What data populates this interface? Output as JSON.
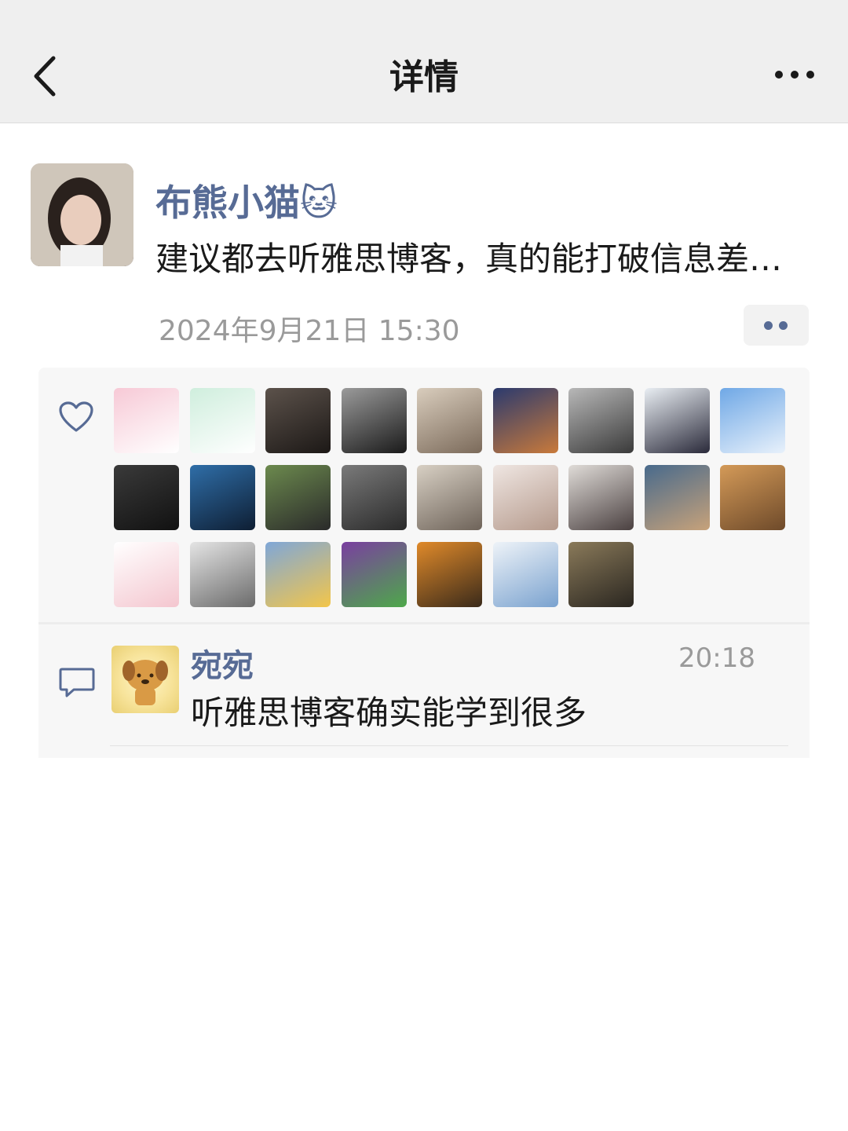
{
  "nav": {
    "title": "详情",
    "back_icon": "chevron-left-icon",
    "more_icon": "ellipsis-icon"
  },
  "post": {
    "author_name": "布熊小猫🐱",
    "text": "建议都去听雅思博客，真的能打破信息差…",
    "timestamp": "2024年9月21日 15:30",
    "action_icon": "two-dot-icon"
  },
  "likes": {
    "icon": "heart-outline-icon",
    "avatars": [
      {
        "name": "like-avatar-1",
        "colors": [
          "#f7c9d6",
          "#ffffff"
        ]
      },
      {
        "name": "like-avatar-2",
        "colors": [
          "#cfeedd",
          "#ffffff"
        ]
      },
      {
        "name": "like-avatar-3",
        "colors": [
          "#5c524b",
          "#1c1816"
        ]
      },
      {
        "name": "like-avatar-4",
        "colors": [
          "#9b9b9b",
          "#1a1a1a"
        ]
      },
      {
        "name": "like-avatar-5",
        "colors": [
          "#d9cdbd",
          "#7b6a5a"
        ]
      },
      {
        "name": "like-avatar-6",
        "colors": [
          "#2b3a6e",
          "#c97a3b"
        ]
      },
      {
        "name": "like-avatar-7",
        "colors": [
          "#b8b8b8",
          "#3a3a3a"
        ]
      },
      {
        "name": "like-avatar-8",
        "colors": [
          "#e9eef3",
          "#2a2a3a"
        ]
      },
      {
        "name": "like-avatar-9",
        "colors": [
          "#6fa8e6",
          "#e8f1fb"
        ]
      },
      {
        "name": "like-avatar-10",
        "colors": [
          "#3a3a3a",
          "#111111"
        ]
      },
      {
        "name": "like-avatar-11",
        "colors": [
          "#2f6ea8",
          "#0e1e33"
        ]
      },
      {
        "name": "like-avatar-12",
        "colors": [
          "#6c8a4e",
          "#2a2a2a"
        ]
      },
      {
        "name": "like-avatar-13",
        "colors": [
          "#7a7a7a",
          "#2a2a2a"
        ]
      },
      {
        "name": "like-avatar-14",
        "colors": [
          "#d8d0c4",
          "#6e6359"
        ]
      },
      {
        "name": "like-avatar-15",
        "colors": [
          "#efe6e2",
          "#b59a8c"
        ]
      },
      {
        "name": "like-avatar-16",
        "colors": [
          "#e0dcd8",
          "#4a4040"
        ]
      },
      {
        "name": "like-avatar-17",
        "colors": [
          "#486a8c",
          "#c7a27a"
        ]
      },
      {
        "name": "like-avatar-18",
        "colors": [
          "#d49a58",
          "#6e4a2a"
        ]
      },
      {
        "name": "like-avatar-19",
        "colors": [
          "#ffffff",
          "#f4c6cf"
        ]
      },
      {
        "name": "like-avatar-20",
        "colors": [
          "#e4e4e4",
          "#6b6b6b"
        ]
      },
      {
        "name": "like-avatar-21",
        "colors": [
          "#7fa7d8",
          "#f3c64a"
        ]
      },
      {
        "name": "like-avatar-22",
        "colors": [
          "#7a3fa0",
          "#4ea84a"
        ]
      },
      {
        "name": "like-avatar-23",
        "colors": [
          "#e08a2a",
          "#3a2a1a"
        ]
      },
      {
        "name": "like-avatar-24",
        "colors": [
          "#eef3f8",
          "#7aa2cf"
        ]
      },
      {
        "name": "like-avatar-25",
        "colors": [
          "#8a7a5a",
          "#2a2620"
        ]
      }
    ]
  },
  "comments": {
    "icon": "speech-bubble-icon",
    "items": [
      {
        "author": "宛宛",
        "time": "20:18",
        "text": "听雅思博客确实能学到很多"
      }
    ]
  },
  "colors": {
    "link_blue": "#576b95",
    "nav_bg": "#efefef",
    "panel_bg": "#f7f7f7",
    "meta_gray": "#9a9a9a"
  }
}
